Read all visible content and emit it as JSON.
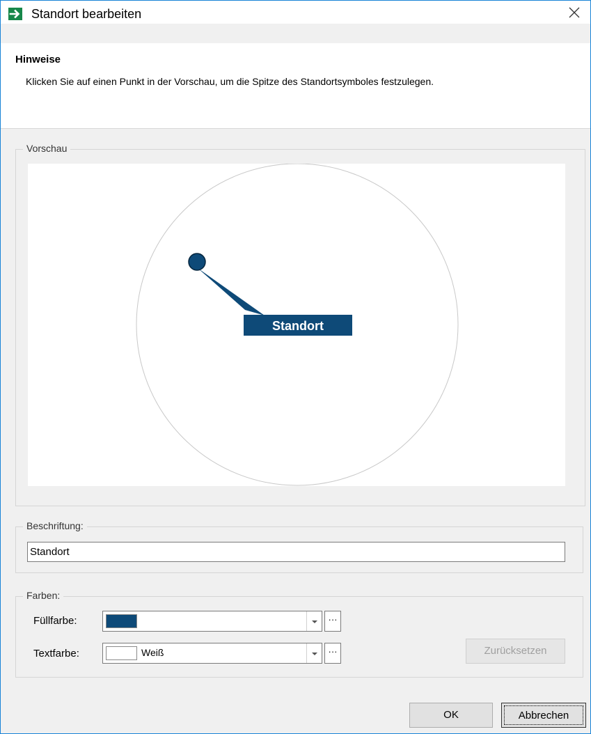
{
  "window": {
    "title": "Standort bearbeiten"
  },
  "hint": {
    "title": "Hinweise",
    "text": "Klicken Sie auf einen Punkt in der Vorschau, um die Spitze des Standortsymboles festzulegen."
  },
  "preview": {
    "legend": "Vorschau",
    "marker_label": "Standort",
    "fill_color": "#0e4a78",
    "text_color": "#ffffff"
  },
  "caption": {
    "legend": "Beschriftung:",
    "value": "Standort"
  },
  "colors": {
    "legend": "Farben:",
    "fill_label": "Füllfarbe:",
    "fill_value": "",
    "fill_swatch": "#0e4a78",
    "text_label": "Textfarbe:",
    "text_value": "Weiß",
    "text_swatch": "#ffffff",
    "more_glyph": "···",
    "reset_label": "Zurücksetzen"
  },
  "buttons": {
    "ok": "OK",
    "cancel": "Abbrechen"
  },
  "icons": {
    "app": "arrow-right-icon",
    "close": "close-icon",
    "dropdown": "chevron-down-icon"
  }
}
